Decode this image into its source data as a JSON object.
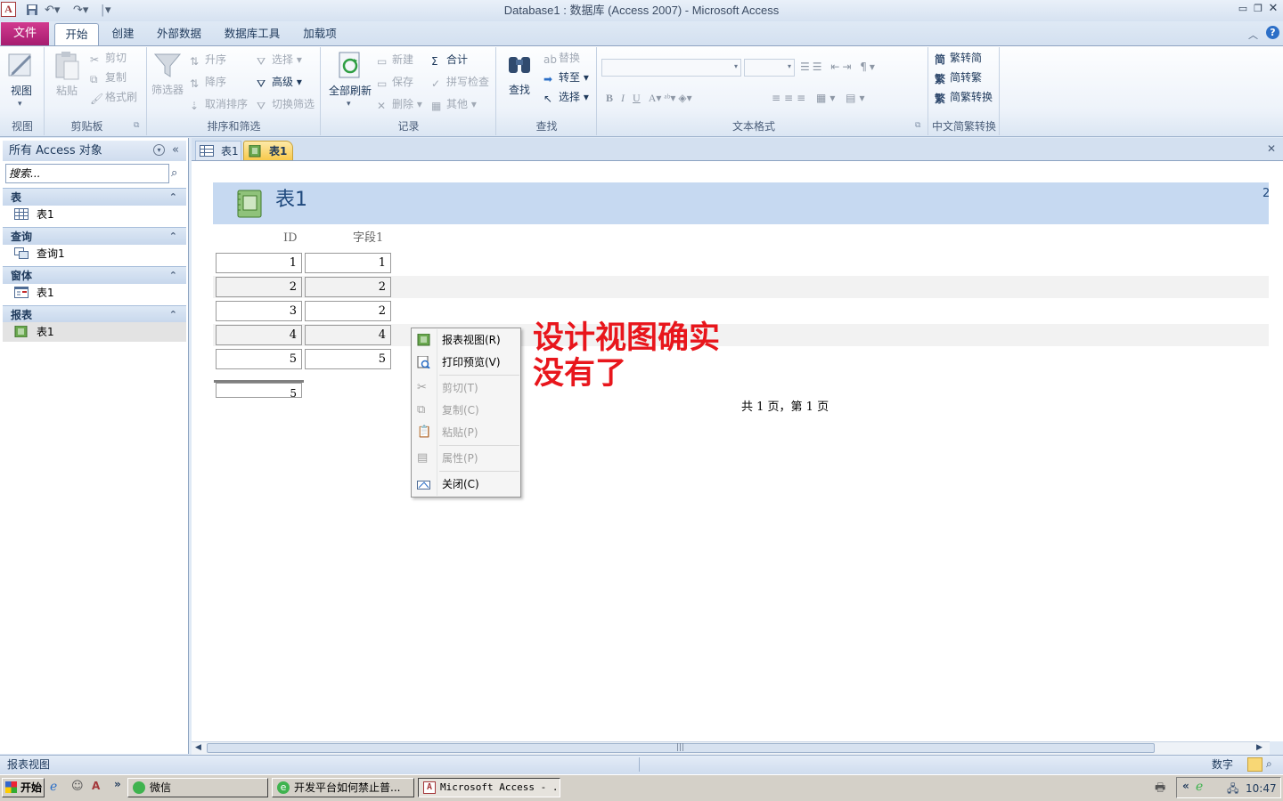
{
  "window": {
    "title": "Database1 : 数据库 (Access 2007)  -  Microsoft Access",
    "app_icon": "A"
  },
  "ribbon_tabs": {
    "file": "文件",
    "home": "开始",
    "create": "创建",
    "external": "外部数据",
    "dbtools": "数据库工具",
    "addins": "加载项"
  },
  "groups": {
    "views": {
      "label": "视图",
      "view": "视图"
    },
    "clipboard": {
      "label": "剪贴板",
      "paste": "粘贴",
      "cut": "剪切",
      "copy": "复制",
      "format_painter": "格式刷"
    },
    "sort_filter": {
      "label": "排序和筛选",
      "filter": "筛选器",
      "asc": "升序",
      "desc": "降序",
      "remove_sort": "取消排序",
      "selection": "选择",
      "advanced": "高级",
      "toggle_filter": "切换筛选"
    },
    "records": {
      "label": "记录",
      "refresh_all": "全部刷新",
      "new": "新建",
      "save": "保存",
      "delete": "删除",
      "totals": "合计",
      "spelling": "拼写检查",
      "more": "其他"
    },
    "find": {
      "label": "查找",
      "find": "查找",
      "replace": "替换",
      "goto": "转至",
      "select": "选择"
    },
    "text_format": {
      "label": "文本格式"
    },
    "chinese": {
      "label": "中文简繁转换",
      "t2s": "繁转简",
      "s2t": "简转繁",
      "convert": "简繁转换"
    }
  },
  "nav": {
    "header": "所有 Access 对象",
    "search_placeholder": "搜索...",
    "sections": [
      {
        "title": "表",
        "item": "表1"
      },
      {
        "title": "查询",
        "item": "查询1"
      },
      {
        "title": "窗体",
        "item": "表1"
      },
      {
        "title": "报表",
        "item": "表1"
      }
    ]
  },
  "doc_tabs": [
    "表1",
    "表1"
  ],
  "report": {
    "title": "表1",
    "corner_text": "2",
    "col_headers": [
      "ID",
      "字段1"
    ],
    "rows": [
      [
        "1",
        "1"
      ],
      [
        "2",
        "2"
      ],
      [
        "3",
        "2"
      ],
      [
        "4",
        "4"
      ],
      [
        "5",
        "5"
      ]
    ],
    "total": "5",
    "page_info": "共 1 页，第 1 页"
  },
  "annotation": {
    "line1": "设计视图确实",
    "line2": "没有了"
  },
  "context_menu": [
    {
      "label": "报表视图(R)",
      "enabled": true,
      "icon": "report-view-icon"
    },
    {
      "label": "打印预览(V)",
      "enabled": true,
      "icon": "print-preview-icon"
    },
    {
      "label": "剪切(T)",
      "enabled": false,
      "icon": "cut-icon"
    },
    {
      "label": "复制(C)",
      "enabled": false,
      "icon": "copy-icon"
    },
    {
      "label": "粘贴(P)",
      "enabled": false,
      "icon": "paste-icon"
    },
    {
      "label": "属性(P)",
      "enabled": false,
      "icon": "properties-icon"
    },
    {
      "label": "关闭(C)",
      "enabled": true,
      "icon": "close-doc-icon"
    }
  ],
  "status": {
    "left": "报表视图",
    "right": "数字"
  },
  "taskbar": {
    "start": "开始",
    "items": [
      "微信",
      "开发平台如何禁止普...",
      "Microsoft Access - ..."
    ],
    "clock": "10:47"
  },
  "colors": {
    "file_tab": "#c42b83",
    "report_band": "#c6d9f1",
    "annotation": "#e8161c"
  }
}
